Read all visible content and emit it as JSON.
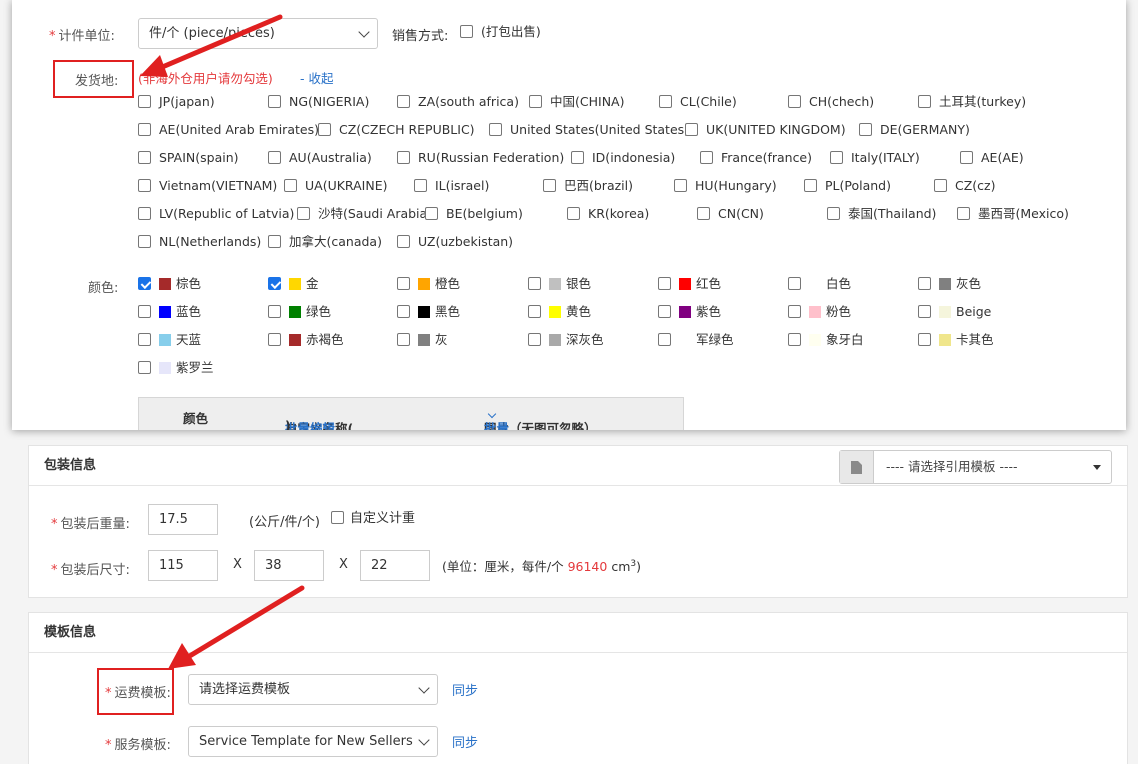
{
  "unit": {
    "label": "计件单位:",
    "value": "件/个 (piece/pieces)"
  },
  "sale_method": {
    "label": "销售方式:",
    "option": "(打包出售)"
  },
  "ship_from": {
    "label": "发货地:",
    "hint": "(非海外仓用户请勿勾选)",
    "collapse": "- 收起",
    "options": [
      "JP(japan)",
      "NG(NIGERIA)",
      "ZA(south africa)",
      "中国(CHINA)",
      "CL(Chile)",
      "CH(chech)",
      "土耳其(turkey)",
      "AE(United Arab Emirates)",
      "CZ(CZECH REPUBLIC)",
      "United States(United States)",
      "UK(UNITED KINGDOM)",
      "DE(GERMANY)",
      "SPAIN(spain)",
      "AU(Australia)",
      "RU(Russian Federation)",
      "ID(indonesia)",
      "France(france)",
      "Italy(ITALY)",
      "AE(AE)",
      "Vietnam(VIETNAM)",
      "UA(UKRAINE)",
      "IL(israel)",
      "巴西(brazil)",
      "HU(Hungary)",
      "PL(Poland)",
      "CZ(cz)",
      "LV(Republic of Latvia)",
      "沙特(Saudi Arabia)",
      "BE(belgium)",
      "KR(korea)",
      "CN(CN)",
      "泰国(Thailand)",
      "墨西哥(Mexico)",
      "NL(Netherlands)",
      "加拿大(canada)",
      "UZ(uzbekistan)"
    ]
  },
  "colors": {
    "label": "颜色:",
    "items": [
      {
        "name": "棕色",
        "swatch": "#a52a2a",
        "checked": true
      },
      {
        "name": "金",
        "swatch": "#ffd700",
        "checked": true
      },
      {
        "name": "橙色",
        "swatch": "#ffa500",
        "checked": false
      },
      {
        "name": "银色",
        "swatch": "#c0c0c0",
        "checked": false
      },
      {
        "name": "红色",
        "swatch": "#ff0000",
        "checked": false
      },
      {
        "name": "白色",
        "swatch": "#ffffff",
        "checked": false
      },
      {
        "name": "灰色",
        "swatch": "#808080",
        "checked": false
      },
      {
        "name": "蓝色",
        "swatch": "#0000ff",
        "checked": false
      },
      {
        "name": "绿色",
        "swatch": "#008000",
        "checked": false
      },
      {
        "name": "黑色",
        "swatch": "#000000",
        "checked": false
      },
      {
        "name": "黄色",
        "swatch": "#ffff00",
        "checked": false
      },
      {
        "name": "紫色",
        "swatch": "#800080",
        "checked": false
      },
      {
        "name": "粉色",
        "swatch": "#ffc0cb",
        "checked": false
      },
      {
        "name": "Beige",
        "swatch": "#f5f5dc",
        "checked": false
      },
      {
        "name": "天蓝",
        "swatch": "#87ceeb",
        "checked": false
      },
      {
        "name": "赤褐色",
        "swatch": "#a52a2a",
        "checked": false
      },
      {
        "name": "灰",
        "swatch": "#808080",
        "checked": false
      },
      {
        "name": "深灰色",
        "swatch": "#a9a9a9",
        "checked": false
      },
      {
        "name": "军绿色",
        "swatch": "#ffffff",
        "checked": false
      },
      {
        "name": "象牙白",
        "swatch": "#fffff0",
        "checked": false
      },
      {
        "name": "卡其色",
        "swatch": "#f0e68c",
        "checked": false
      },
      {
        "name": "紫罗兰",
        "swatch": "#e6e6fa",
        "checked": false
      }
    ]
  },
  "color_table": {
    "col_color": "颜色",
    "col_custom_prefix": "自定义名称(",
    "col_custom_link": "批量编辑",
    "col_custom_suffix": ")",
    "col_image": "图片（无图可忽略）",
    "col_image_link": "批量"
  },
  "packaging": {
    "title": "包装信息",
    "template_placeholder": "---- 请选择引用模板 ----",
    "weight_label": "包装后重量:",
    "weight_value": "17.5",
    "weight_unit": "(公斤/件/个)",
    "custom_weight": "自定义计重",
    "size_label": "包装后尺寸:",
    "length": "115",
    "width": "38",
    "height": "22",
    "times": "X",
    "size_unit_prefix": "(单位：厘米，每件/个",
    "volume": "96140",
    "volume_unit": "cm",
    "volume_sup": "3",
    "size_unit_suffix": ")"
  },
  "template": {
    "title": "模板信息",
    "shipping_label": "运费模板:",
    "shipping_value": "请选择运费模板",
    "service_label": "服务模板:",
    "service_value": "Service Template for New Sellers",
    "sync": "同步"
  },
  "colors_theme": {
    "accent_red": "#e02020",
    "link": "#2a72c8",
    "checkbox_checked": "#1a73e8"
  }
}
